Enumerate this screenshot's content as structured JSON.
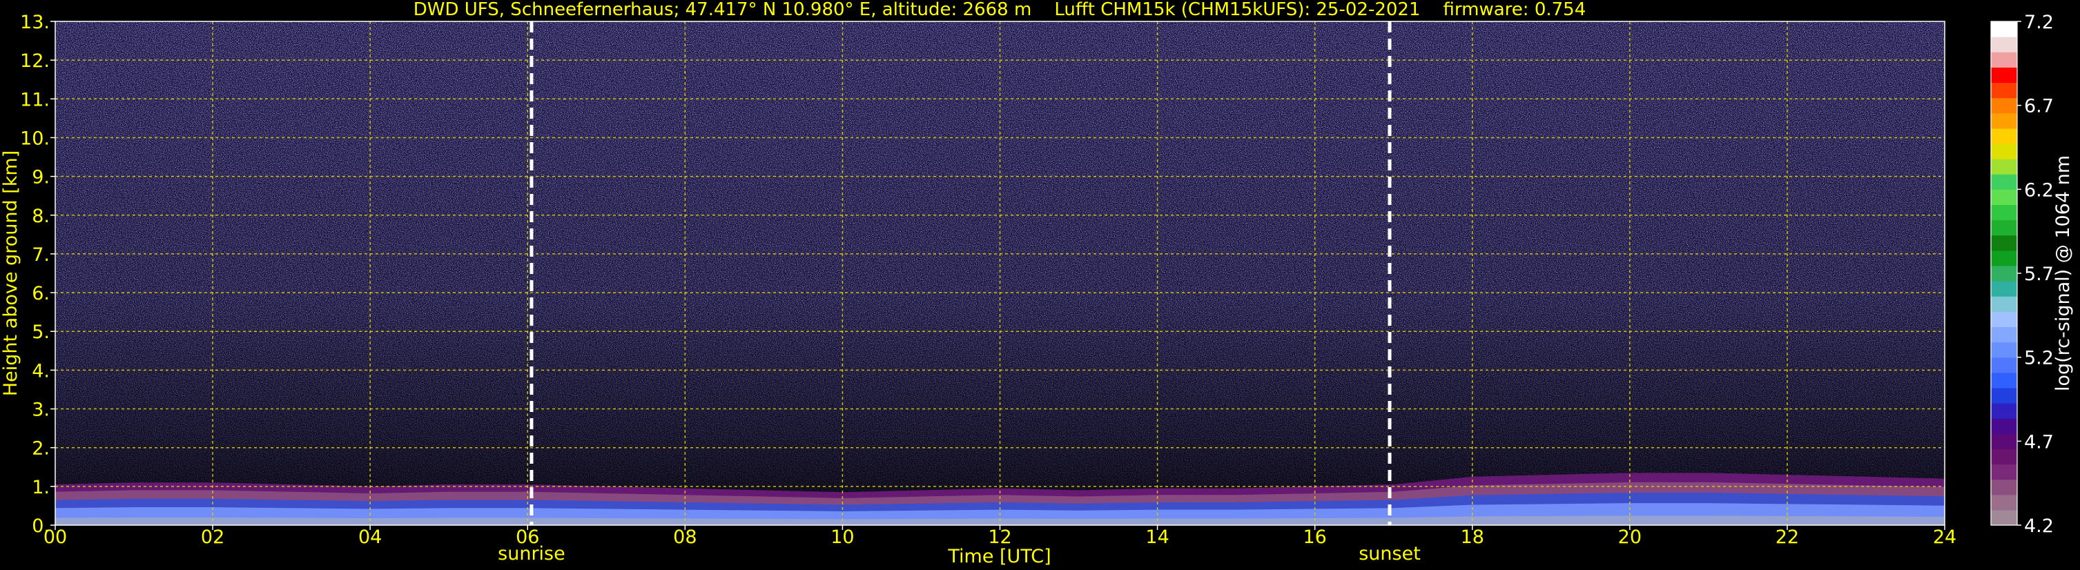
{
  "chart_data": {
    "type": "heatmap",
    "title": "DWD UFS, Schneefernerhaus; 47.417° N 10.980° E, altitude: 2668 m    Lufft CHM15k (CHM15kUFS): 25-02-2021    firmware: 0.754",
    "xlabel": "Time [UTC]",
    "ylabel": "Height above ground [km]",
    "xlim": [
      0,
      24
    ],
    "ylim": [
      0,
      13
    ],
    "x_ticks": [
      "00",
      "02",
      "04",
      "06",
      "08",
      "10",
      "12",
      "14",
      "16",
      "18",
      "20",
      "22",
      "24"
    ],
    "x_tick_values": [
      0,
      2,
      4,
      6,
      8,
      10,
      12,
      14,
      16,
      18,
      20,
      22,
      24
    ],
    "y_ticks": [
      "0.",
      "1.",
      "2.",
      "3.",
      "4.",
      "5.",
      "6.",
      "7.",
      "8.",
      "9.",
      "10.",
      "11.",
      "12.",
      "13."
    ],
    "y_tick_values": [
      0,
      1,
      2,
      3,
      4,
      5,
      6,
      7,
      8,
      9,
      10,
      11,
      12,
      13
    ],
    "grid": true,
    "annotations": [
      {
        "label": "sunrise",
        "x": 6.05
      },
      {
        "label": "sunset",
        "x": 16.95
      }
    ],
    "colorbar": {
      "label": "log(rc-signal) @ 1064 nm",
      "range": [
        4.2,
        7.2
      ],
      "ticks": [
        "4.2",
        "4.7",
        "5.2",
        "5.7",
        "6.2",
        "6.7",
        "7.2"
      ],
      "tick_values": [
        4.2,
        4.7,
        5.2,
        5.7,
        6.2,
        6.7,
        7.2
      ],
      "colors": [
        "#a08a98",
        "#9a6f8c",
        "#8c4f80",
        "#7a2a78",
        "#6a1470",
        "#5c0a78",
        "#4a0a90",
        "#3020c0",
        "#2040e0",
        "#3060ff",
        "#5078ff",
        "#6890ff",
        "#84a8ff",
        "#a0c0ff",
        "#80c8d8",
        "#30b0a0",
        "#30b060",
        "#10a020",
        "#108010",
        "#20b030",
        "#30c840",
        "#60e050",
        "#40d060",
        "#a0e030",
        "#e0e000",
        "#ffd000",
        "#ffa000",
        "#ff8000",
        "#ff4000",
        "#ff0000",
        "#f0a0a0",
        "#f0d8d8",
        "#ffffff"
      ]
    },
    "boundary_layer": {
      "description_free": true,
      "top_km": [
        [
          0,
          1.05
        ],
        [
          1,
          1.1
        ],
        [
          2,
          1.1
        ],
        [
          3,
          1.05
        ],
        [
          4,
          1.0
        ],
        [
          5,
          1.05
        ],
        [
          6,
          1.05
        ],
        [
          7,
          1.0
        ],
        [
          8,
          0.95
        ],
        [
          9,
          0.9
        ],
        [
          10,
          0.85
        ],
        [
          11,
          0.9
        ],
        [
          12,
          0.95
        ],
        [
          13,
          0.9
        ],
        [
          14,
          0.95
        ],
        [
          15,
          0.95
        ],
        [
          16,
          1.0
        ],
        [
          17,
          1.05
        ],
        [
          18,
          1.25
        ],
        [
          19,
          1.3
        ],
        [
          20,
          1.35
        ],
        [
          21,
          1.35
        ],
        [
          22,
          1.3
        ],
        [
          23,
          1.25
        ],
        [
          24,
          1.2
        ]
      ]
    },
    "colors": {
      "background": "#000000",
      "text": "#ffff00",
      "grid": "#e0d000",
      "marker_line": "#ffffff"
    }
  }
}
